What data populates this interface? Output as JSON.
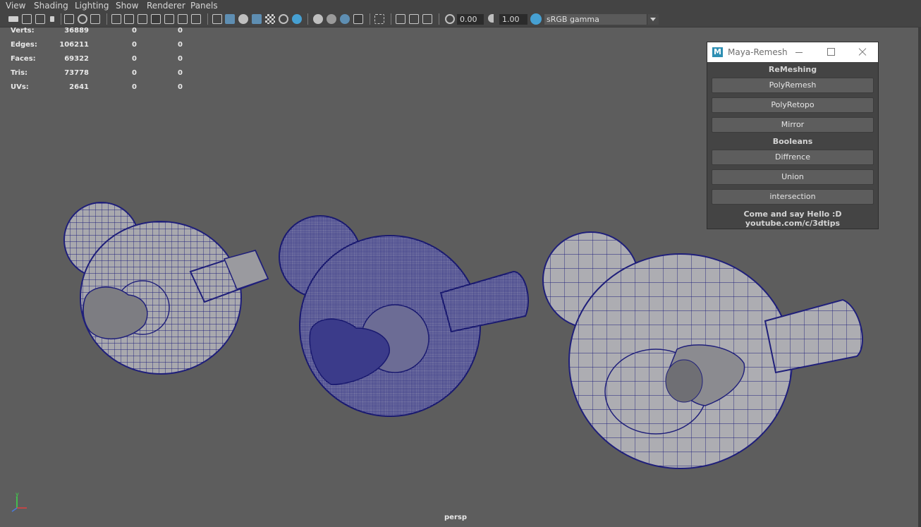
{
  "menu": {
    "items": [
      "View",
      "Shading",
      "Lighting",
      "Show",
      "Renderer",
      "Panels"
    ]
  },
  "toolbar": {
    "exposure_value": "0.00",
    "gamma_value": "1.00",
    "color_space": "sRGB gamma"
  },
  "hud": {
    "rows": [
      {
        "label": "Verts:",
        "v1": "36889",
        "v2": "0",
        "v3": "0"
      },
      {
        "label": "Edges:",
        "v1": "106211",
        "v2": "0",
        "v3": "0"
      },
      {
        "label": "Faces:",
        "v1": "69322",
        "v2": "0",
        "v3": "0"
      },
      {
        "label": "Tris:",
        "v1": "73778",
        "v2": "0",
        "v3": "0"
      },
      {
        "label": "UVs:",
        "v1": "2641",
        "v2": "0",
        "v3": "0"
      }
    ]
  },
  "viewport": {
    "camera_label": "persp",
    "axis_label": "y"
  },
  "panel": {
    "logo_letter": "M",
    "title": "Maya-Remesh",
    "section_remeshing": "ReMeshing",
    "btn_polyremesh": "PolyRemesh",
    "btn_polyretopo": "PolyRetopo",
    "btn_mirror": "Mirror",
    "section_booleans": "Booleans",
    "btn_diffrence": "Diffrence",
    "btn_union": "Union",
    "btn_intersection": "intersection",
    "footer_line1": "Come and say Hello :D",
    "footer_line2": "youtube.com/c/3dtips"
  },
  "colors": {
    "viewport_bg": "#5d5d5d",
    "wire": "#1f1f7a",
    "mesh_fill": "#a9a9ae",
    "ui_bg": "#444444"
  },
  "icons": {
    "toolbar": [
      "camera-icon",
      "camera-attributes-icon",
      "bookmark-icon",
      "image-plane-icon",
      "2d-pan-zoom-icon",
      "grease-pencil-icon",
      "grid-icon",
      "film-gate-icon",
      "resolution-gate-icon",
      "gate-mask-icon",
      "field-chart-icon",
      "safe-action-icon",
      "safe-title-icon",
      "wireframe-icon",
      "smooth-shade-icon",
      "default-material-icon",
      "wireframe-on-shaded-icon",
      "textured-icon",
      "use-all-lights-icon",
      "shadows-icon",
      "screen-space-ao-icon",
      "motion-blur-icon",
      "multisample-aa-icon",
      "depth-of-field-icon",
      "isolate-select-icon",
      "xray-icon",
      "xray-active-components-icon",
      "xray-joints-icon",
      "exposure-icon",
      "gamma-icon",
      "color-management-icon"
    ]
  }
}
